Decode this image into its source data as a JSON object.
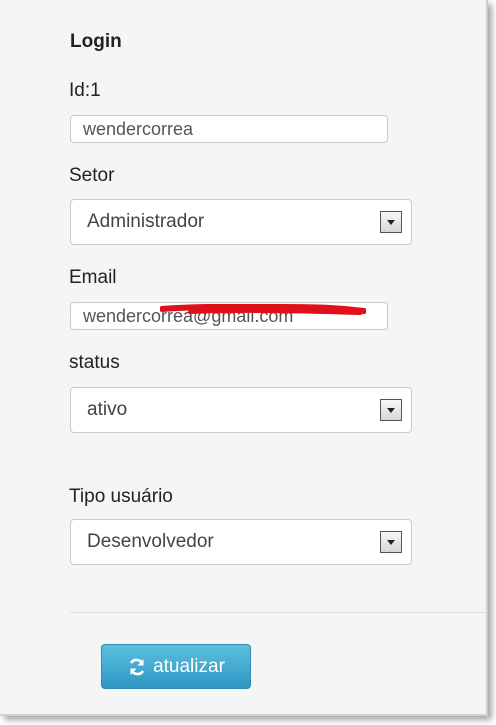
{
  "form": {
    "title": "Login",
    "id_label": "Id:1",
    "login_value": "wendercorrea",
    "setor_label": "Setor",
    "setor_selected": "Administrador",
    "email_label": "Email",
    "email_value": "wendercorrea@gmail.com",
    "status_label": "status",
    "status_selected": "ativo",
    "tipo_label": "Tipo usuário",
    "tipo_selected": "Desenvolvedor",
    "submit_label": "atualizar"
  },
  "colors": {
    "button_top": "#5bc0de",
    "button_bottom": "#2f96c4",
    "redaction": "#e0101a",
    "panel_background": "#f5f5f5"
  },
  "icons": {
    "submit": "refresh-icon",
    "select": "dropdown-arrow-icon"
  }
}
